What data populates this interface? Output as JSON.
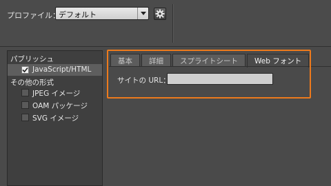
{
  "profile": {
    "label": "プロファイル：",
    "selected": "デフォルト"
  },
  "sidebar": {
    "publish_header": "パブリッシュ",
    "other_header": "その他の形式",
    "items": [
      {
        "label": "JavaScript/HTML",
        "checked": true
      },
      {
        "label": "JPEG イメージ",
        "checked": false
      },
      {
        "label": "OAM パッケージ",
        "checked": false
      },
      {
        "label": "SVG イメージ",
        "checked": false
      }
    ]
  },
  "tabs": [
    {
      "label": "基本"
    },
    {
      "label": "詳細"
    },
    {
      "label": "スプライトシート"
    },
    {
      "label": "Web フォント",
      "active": true
    }
  ],
  "webfont": {
    "url_label": "サイトの URL：",
    "url_value": ""
  },
  "colors": {
    "highlight": "#ee7a1c"
  }
}
